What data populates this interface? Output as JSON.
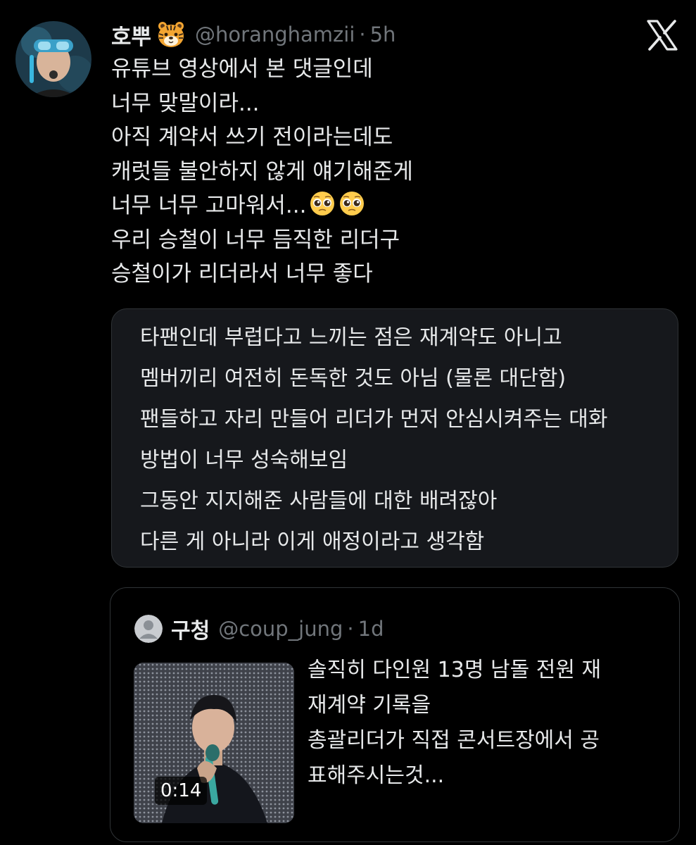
{
  "tweet": {
    "author_name": "호뿌",
    "author_badge_icon": "tiger-face-emoji",
    "handle": "@horanghamzii",
    "separator": "·",
    "time": "5h",
    "lines": [
      "유튜브 영상에서 본 댓글인데",
      "너무 맞말이라...",
      "아직 계약서 쓰기 전이라는데도",
      "캐럿들 불안하지 않게 얘기해준게",
      "너무 너무 고마워서...",
      "우리 승철이 너무 듬직한 리더구",
      "승철이가 리더라서 너무 좋다"
    ],
    "emoji_icon": "pleading-face-emoji",
    "quoted_comment_lines": [
      "타팬인데 부럽다고 느끼는 점은 재계약도 아니고",
      "멤버끼리 여전히 돈독한 것도 아님 (물론 대단함)",
      "팬들하고 자리 만들어 리더가 먼저 안심시켜주는 대화",
      "방법이 너무 성숙해보임",
      "그동안 지지해준 사람들에 대한 배려잖아",
      "다른 게 아니라 이게 애정이라고 생각함"
    ]
  },
  "quoted_tweet": {
    "author_name": "구청",
    "handle": "@coup_jung",
    "separator": "·",
    "time": "1d",
    "video_duration": "0:14",
    "lines": [
      "솔직히 다인원 13명 남돌 전원 재",
      "재계약 기록을",
      "총괄리더가 직접 콘서트장에서 공",
      "표해주시는것..."
    ]
  },
  "colors": {
    "background": "#000000",
    "text_primary": "#e7e9ea",
    "text_secondary": "#71767b",
    "card_border": "#2f3336",
    "screenshot_box_bg": "#16181c"
  }
}
